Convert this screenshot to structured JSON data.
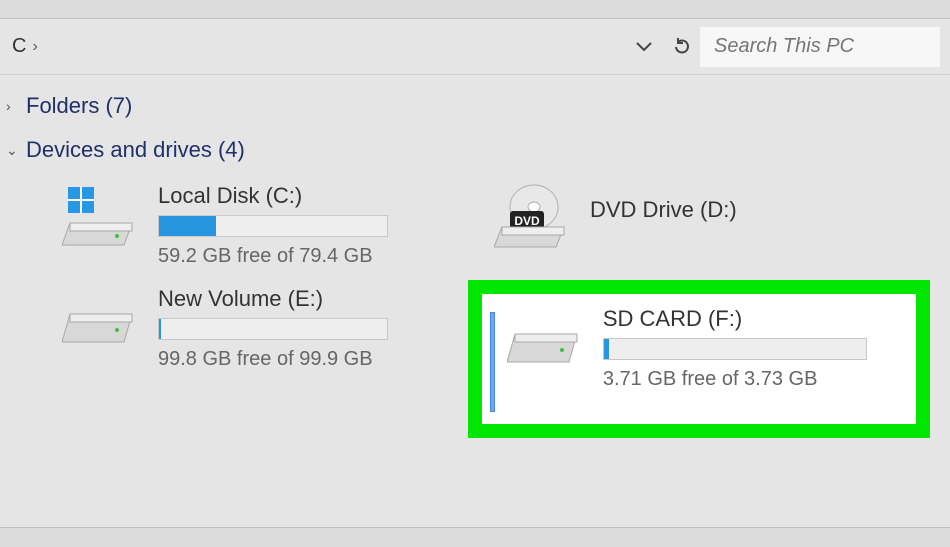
{
  "breadcrumb": {
    "label": "C"
  },
  "search": {
    "placeholder": "Search This PC"
  },
  "sections": {
    "folders": {
      "label": "Folders (7)"
    },
    "devices": {
      "label": "Devices and drives (4)"
    }
  },
  "drives": {
    "c": {
      "name": "Local Disk (C:)",
      "free": "59.2 GB free of 79.4 GB",
      "fill_pct": 25
    },
    "d": {
      "name": "DVD Drive (D:)"
    },
    "e": {
      "name": "New Volume (E:)",
      "free": "99.8 GB free of 99.9 GB",
      "fill_pct": 1
    },
    "f": {
      "name": "SD CARD (F:)",
      "free": "3.71 GB free of 3.73 GB",
      "fill_pct": 2
    }
  }
}
